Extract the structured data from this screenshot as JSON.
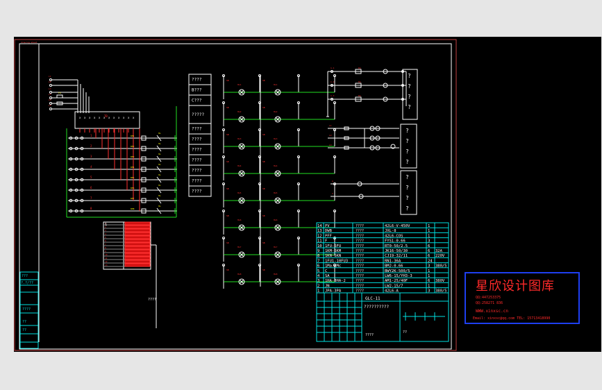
{
  "watermark": {
    "title": "星欣设计图库",
    "www": "WWW.xinxsc.cn"
  },
  "ui": {
    "q1": "?",
    "q2": "??",
    "q3": "???",
    "q4": "????",
    "q5": "?????",
    "b_label": "B???",
    "c_label": "C???",
    "edge_label": "?.?/??",
    "doc_label": "??????????",
    "doc_code": "GLC-11"
  },
  "legend_panel": [
    "????",
    "B???",
    "C???",
    "?????",
    "????",
    "????",
    "????",
    "????",
    "????",
    "????",
    "????"
  ],
  "bom_rows": [
    {
      "no": "14",
      "code": "PV",
      "spec": "42L6-V-450V",
      "qty": "1",
      "rating": ""
    },
    {
      "no": "13",
      "code": "DWB",
      "spec": "JXL-8",
      "qty": "1",
      "rating": ""
    },
    {
      "no": "12",
      "code": "PFF",
      "spec": "42L6-COS",
      "qty": "1",
      "rating": ""
    },
    {
      "no": "11",
      "code": "F",
      "spec": "FYS1-0.66",
      "qty": "3",
      "rating": ""
    },
    {
      "no": "10",
      "code": "1FU-6FU",
      "spec": "RT0-50/2.5",
      "qty": "6",
      "rating": ""
    },
    {
      "no": "9",
      "code": "1KM-6KM",
      "spec": "JK16-50/30",
      "qty": "6",
      "rating": "32A"
    },
    {
      "no": "8",
      "code": "1KN-6KN",
      "spec": "CJ19-32/11",
      "qty": "6",
      "rating": "220V"
    },
    {
      "no": "7",
      "code": "1FU1-10FU3",
      "spec": "RN1-36A",
      "qty": "24",
      "rating": ""
    },
    {
      "no": "6",
      "code": "1Ma-1Mc",
      "spec": "BMJ-0.66",
      "qty": "3",
      "rating": "380/5"
    },
    {
      "no": "5",
      "code": "C",
      "spec": "BWY2K-500/5",
      "qty": "1",
      "rating": ""
    },
    {
      "no": "4",
      "code": "SA",
      "spec": "LW6-15/YH3-3",
      "qty": "1",
      "rating": ""
    },
    {
      "no": "3",
      "code": "1HA-3HA-2",
      "spec": "AM1-25/40F",
      "qty": "6",
      "rating": "380V"
    },
    {
      "no": "2",
      "code": "JN",
      "spec": "LW2-15/7",
      "qty": "1",
      "rating": ""
    },
    {
      "no": "1",
      "code": "JPA-3PA",
      "spec": "42L6-A",
      "qty": "3",
      "rating": "380/5"
    }
  ]
}
